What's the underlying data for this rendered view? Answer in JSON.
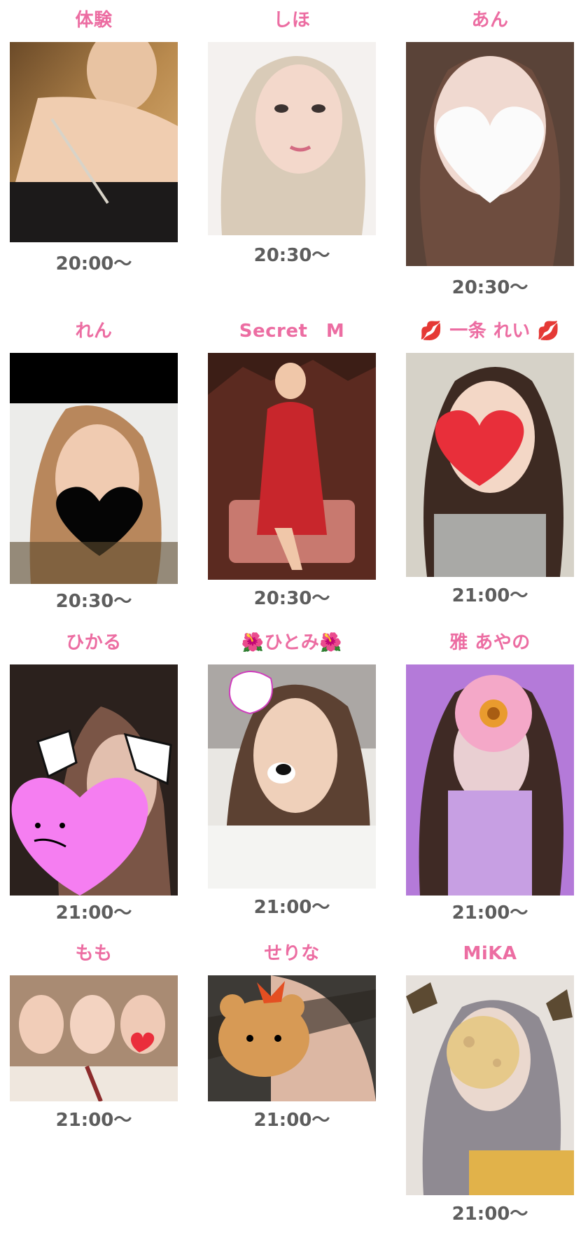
{
  "cast_list": [
    {
      "name": "体験",
      "time": "20:00〜",
      "photo_icon": "portrait-photo-icon"
    },
    {
      "name": "しほ",
      "time": "20:30〜",
      "photo_icon": "portrait-photo-icon"
    },
    {
      "name": "あん",
      "time": "20:30〜",
      "photo_icon": "heart-mask-photo-icon"
    },
    {
      "name": "れん",
      "time": "20:30〜",
      "photo_icon": "heart-mask-photo-icon"
    },
    {
      "name": "Secret　M",
      "time": "20:30〜",
      "photo_icon": "portrait-photo-icon"
    },
    {
      "name": "💋 一条 れい 💋",
      "time": "21:00〜",
      "photo_icon": "heart-mask-photo-icon"
    },
    {
      "name": "ひかる",
      "time": "21:00〜",
      "photo_icon": "heart-mask-photo-icon"
    },
    {
      "name": "🌺ひとみ🌺",
      "time": "21:00〜",
      "photo_icon": "dog-filter-photo-icon"
    },
    {
      "name": "雅 あやの",
      "time": "21:00〜",
      "photo_icon": "flower-mask-photo-icon"
    },
    {
      "name": "もも",
      "time": "21:00〜",
      "photo_icon": "group-photo-icon"
    },
    {
      "name": "せりな",
      "time": "21:00〜",
      "photo_icon": "bear-mask-photo-icon"
    },
    {
      "name": "MiKA",
      "time": "21:00〜",
      "photo_icon": "moon-mask-photo-icon"
    }
  ],
  "colors": {
    "name_pink": "#ec6da2",
    "time_gray": "#5d5d5d",
    "background": "#ffffff"
  }
}
